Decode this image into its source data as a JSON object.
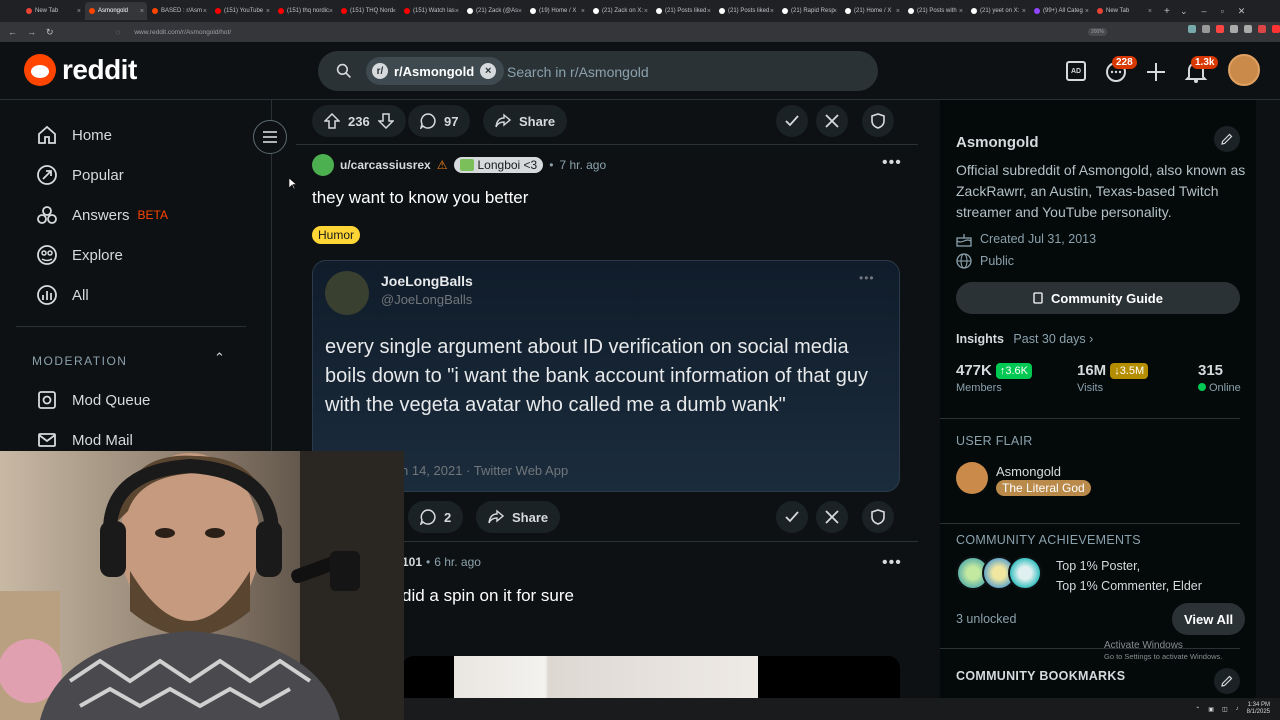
{
  "browser": {
    "tabs": [
      {
        "label": "New Tab",
        "color": "#ea4335"
      },
      {
        "label": "Asmongold",
        "color": "#ff4500",
        "active": true
      },
      {
        "label": "BASED : r/Asm",
        "color": "#ff4500"
      },
      {
        "label": "(151) YouTube",
        "color": "#ff0000"
      },
      {
        "label": "(151) thq nordic",
        "color": "#ff0000"
      },
      {
        "label": "(151) THQ Nord",
        "color": "#ff0000"
      },
      {
        "label": "(151) Watch las",
        "color": "#ff0000"
      },
      {
        "label": "(21) Zack (@As",
        "color": "#fff"
      },
      {
        "label": "(19) Home / X",
        "color": "#fff"
      },
      {
        "label": "(21) Zack on X:",
        "color": "#fff"
      },
      {
        "label": "(21) Posts liked",
        "color": "#fff"
      },
      {
        "label": "(21) Posts liked",
        "color": "#fff"
      },
      {
        "label": "(21) Rapid Resp",
        "color": "#fff"
      },
      {
        "label": "(21) Home / X",
        "color": "#fff"
      },
      {
        "label": "(21) Posts with",
        "color": "#fff"
      },
      {
        "label": "(21) yeet on X:",
        "color": "#fff"
      },
      {
        "label": "(99+) All Categ",
        "color": "#9146ff"
      },
      {
        "label": "New Tab",
        "color": "#ea4335"
      }
    ],
    "url": "www.reddit.com/r/Asmongold/hot/",
    "zoom": "200%"
  },
  "header": {
    "logo_text": "reddit",
    "search_chip": "r/Asmongold",
    "search_placeholder": "Search in r/Asmongold",
    "chat_badge": "228",
    "notif_badge": "1.3k"
  },
  "sidebar": {
    "items": [
      {
        "label": "Home"
      },
      {
        "label": "Popular"
      },
      {
        "label": "Answers",
        "tag": "BETA"
      },
      {
        "label": "Explore"
      },
      {
        "label": "All"
      }
    ],
    "moderation_heading": "MODERATION",
    "mod_items": [
      {
        "label": "Mod Queue"
      },
      {
        "label": "Mod Mail"
      }
    ]
  },
  "feed": {
    "prev_post": {
      "votes": "236",
      "comments": "97",
      "share": "Share"
    },
    "post": {
      "author": "u/carcassiusrex",
      "user_flair": "Longboi <3",
      "time": "7 hr. ago",
      "title": "they want to know you better",
      "flair": "Humor",
      "tweet": {
        "name": "JoeLongBalls",
        "handle": "@JoeLongBalls",
        "text": "every single argument about ID verification on social media boils down to \"i want the bank account information of that guy with the vegeta avatar who called me a dumb wank\"",
        "footer": "n 14, 2021 · Twitter Web App"
      },
      "comments": "2",
      "share": "Share"
    },
    "next_post": {
      "author_partial": "101",
      "time": "6 hr. ago",
      "title": "did a spin on it for sure"
    }
  },
  "community": {
    "name": "Asmongold",
    "description": "Official subreddit of Asmongold, also known as ZackRawrr, an Austin, Texas-based Twitch streamer and YouTube personality.",
    "created": "Created Jul 31, 2013",
    "visibility": "Public",
    "guide_button": "Community Guide",
    "insights_label": "Insights",
    "insights_period": "Past 30 days",
    "stats": {
      "members": "477K",
      "members_change": "3.6K",
      "members_label": "Members",
      "visits": "16M",
      "visits_change": "3.5M",
      "visits_label": "Visits",
      "online": "315",
      "online_label": "Online"
    },
    "user_flair_heading": "USER FLAIR",
    "user_flair_name": "Asmongold",
    "user_flair_tag": "The Literal God",
    "achievements_heading": "COMMUNITY ACHIEVEMENTS",
    "achievements_text1": "Top 1% Poster,",
    "achievements_text2": "Top 1% Commenter, Elder",
    "unlocked": "3 unlocked",
    "view_all": "View All",
    "bookmarks_heading": "COMMUNITY BOOKMARKS"
  },
  "os": {
    "activate_title": "Activate Windows",
    "activate_sub": "Go to Settings to activate Windows.",
    "time": "1:34 PM",
    "date": "8/1/2025"
  },
  "colors": {
    "accent": "#ff4500",
    "humor": "#ffd635",
    "up": "#00c853",
    "down": "#b58d00"
  }
}
